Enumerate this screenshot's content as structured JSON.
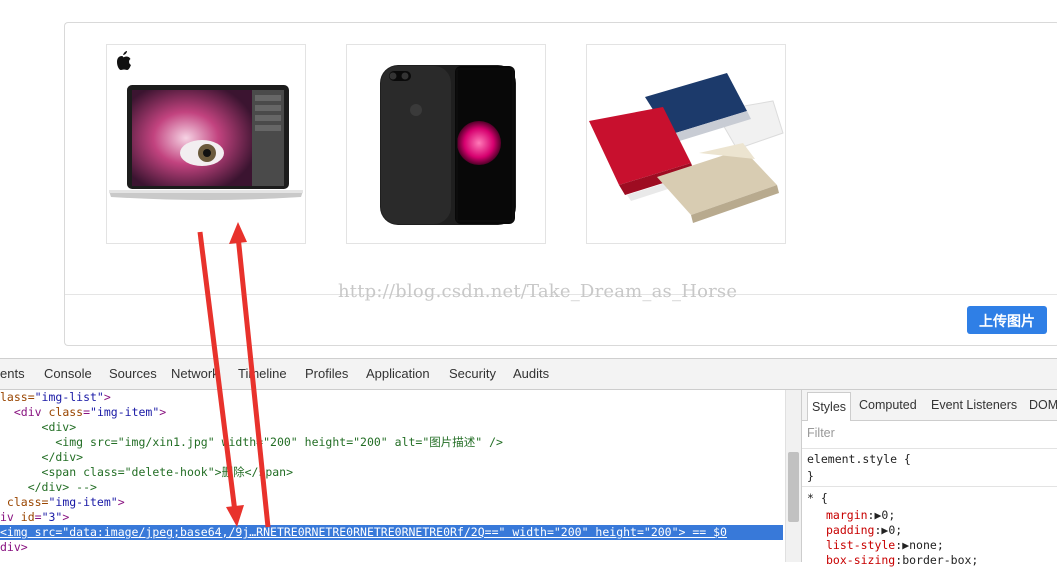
{
  "page": {
    "upload_button": "上传图片",
    "watermark": "http://blog.csdn.net/Take_Dream_as_Horse",
    "images": [
      {
        "icon": "apple-logo-icon",
        "subject": "macbook-laptop"
      },
      {
        "icon": "",
        "subject": "iphone-black"
      },
      {
        "icon": "",
        "subject": "asus-laptops"
      }
    ]
  },
  "devtools": {
    "tabs": [
      "ents",
      "Console",
      "Sources",
      "Network",
      "Timeline",
      "Profiles",
      "Application",
      "Security",
      "Audits"
    ],
    "styles_tabs": [
      "Styles",
      "Computed",
      "Event Listeners",
      "DOM"
    ],
    "filter_placeholder": "Filter",
    "elements_lines": [
      {
        "pre": "lass=",
        "attr_value": "\"img-list\"",
        "post": ">"
      },
      {
        "pre": "  <div ",
        "attr_name": "class",
        "attr_value": "\"img-item\"",
        "post": ">"
      },
      {
        "pre": "      <div>"
      },
      {
        "pre": "        <img ",
        "rest": "src=\"img/xin1.jpg\" width=\"200\" height=\"200\" alt=\"图片描述\" />"
      },
      {
        "pre": "      </div>"
      },
      {
        "pre": "      <span ",
        "rest": "class=\"delete-hook\">删除</span>"
      },
      {
        "pre": "    </div> -->"
      },
      {
        "pre": " class=",
        "attr_value": "\"img-item\"",
        "post": ">"
      },
      {
        "pre": "iv ",
        "attr_name": "id",
        "attr_value": "\"3\"",
        "post": ">"
      },
      {
        "selected": "<img src=\"data:image/jpeg;base64,/9j…RNETRE0RNETRE0RNETRE0RNETRE0Rf/2Q==\" width=\"200\" height=\"200\"> == $0"
      },
      {
        "pre": "div>"
      }
    ],
    "styles": {
      "element_style": "element.style {",
      "element_close": "}",
      "universal": "* {",
      "rules": [
        {
          "name": "margin",
          "value": "0;"
        },
        {
          "name": "padding",
          "value": "0;"
        },
        {
          "name": "list-style",
          "value": "none;"
        },
        {
          "name": "box-sizing",
          "value": "border-box;"
        }
      ]
    }
  },
  "colors": {
    "upload_button": "#2f7fe6",
    "selection": "#3879d9",
    "annotation_arrows": "#e8322c"
  }
}
